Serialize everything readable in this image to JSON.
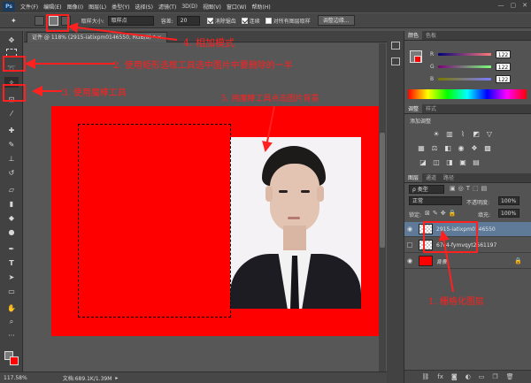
{
  "menubar": {
    "app_glyph": "Ps",
    "items": [
      "文件(F)",
      "编辑(E)",
      "图像(I)",
      "图层(L)",
      "类型(Y)",
      "选择(S)",
      "滤镜(T)",
      "3D(D)",
      "视图(V)",
      "窗口(W)",
      "帮助(H)"
    ],
    "window_controls": [
      "—",
      "▢",
      "✕"
    ]
  },
  "options": {
    "sample_label": "取样大小:",
    "sample_value": "取样点",
    "tolerance_label": "容差:",
    "tolerance_value": "20",
    "antialias": "消除锯齿",
    "contiguous": "连续",
    "all_layers": "对所有图层取样",
    "refine_button": "调整边缘..."
  },
  "doc_tab": {
    "title": "证件 @ 118% (2915-iatixpm0146550, RGB/8) * ×"
  },
  "status": {
    "zoom": "117.58%",
    "doc": "文档:689.1K/1.39M"
  },
  "color_panel": {
    "tabs": [
      "颜色",
      "色板"
    ],
    "r_label": "R",
    "g_label": "G",
    "b_label": "B",
    "r": "122",
    "g": "122",
    "b": "122"
  },
  "adjust_panel": {
    "tabs": [
      "调整",
      "样式"
    ],
    "title": "添加调整"
  },
  "layers_panel": {
    "tabs": [
      "图层",
      "通道",
      "路径"
    ],
    "kind_label": "ρ 类型",
    "blend_mode": "正常",
    "opacity_label": "不透明度:",
    "opacity": "100%",
    "lock_label": "锁定:",
    "fill_label": "填充:",
    "fill": "100%"
  },
  "layers": [
    {
      "name": "2915-iatixpm0146550",
      "selected": true,
      "visible": true
    },
    {
      "name": "67c4-fymvqyt2561197",
      "selected": false,
      "visible": false
    },
    {
      "name": "背景",
      "selected": false,
      "visible": true,
      "locked": true
    }
  ],
  "annotations": {
    "a1": "1. 栅格化图层",
    "a2": "2. 使用矩形选框工具选中图片中要删除的一半",
    "a3": "3. 使用魔棒工具",
    "a4": "4. 相加模式",
    "a5": "5. 用魔棒工具点击图片背景"
  },
  "colors": {
    "accent_red": "#ff0000",
    "panel_bg": "#535353",
    "dark_bg": "#3a3a3a"
  }
}
